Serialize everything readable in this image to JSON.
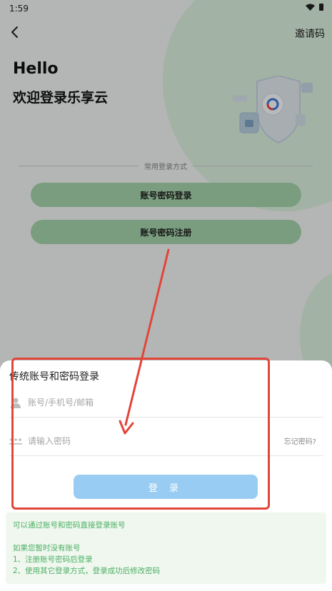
{
  "status_bar": {
    "time": "1:59"
  },
  "header": {
    "back_icon": "chevron-left-icon",
    "invite_label": "邀请码"
  },
  "greeting": {
    "hello": "Hello",
    "welcome": "欢迎登录乐享云"
  },
  "login_methods": {
    "divider_text": "常用登录方式",
    "account_login_label": "账号密码登录",
    "account_register_label": "账号密码注册"
  },
  "sheet": {
    "title": "传统账号和密码登录",
    "account_placeholder": "账号/手机号/邮箱",
    "password_placeholder": "请输入密码",
    "forgot_label": "忘记密码?",
    "login_button_label": "登 录"
  },
  "info": {
    "line1": "可以通过账号和密码直接登录账号",
    "line2": "如果您暂时没有账号",
    "line3": "1、注册账号密码后登录",
    "line4": "2、使用其它登录方式，登录成功后修改密码"
  },
  "colors": {
    "accent_green": "#a8d8ae",
    "login_button": "#99ccf2",
    "info_text": "#4caf63",
    "annotation_red": "#e2453a"
  }
}
